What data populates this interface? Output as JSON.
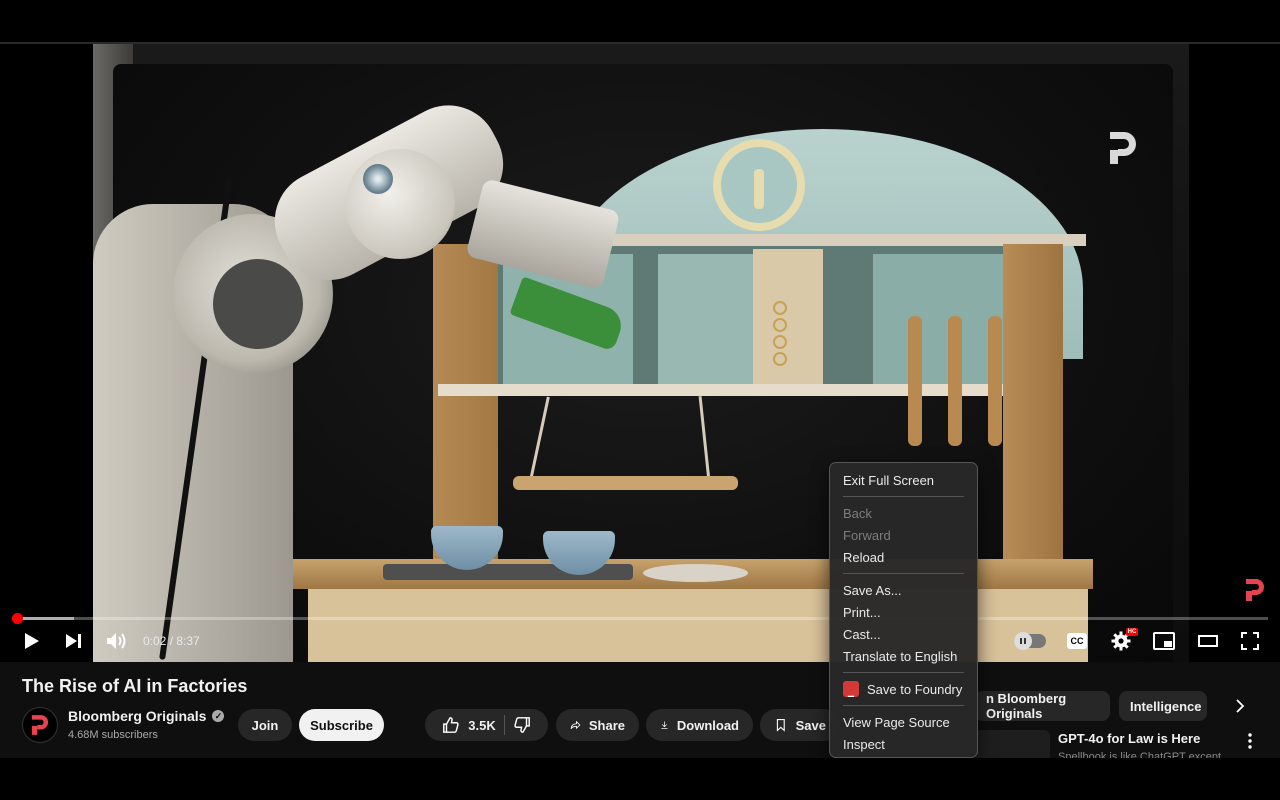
{
  "video": {
    "current_time": "0:02",
    "duration": "8:37",
    "time_separator": " / ",
    "cc_label": "CC",
    "hd_label": "HC",
    "progress": 0.004
  },
  "info": {
    "title": "The Rise of AI in Factories",
    "channel_name": "Bloomberg Originals",
    "subscribers": "4.68M subscribers",
    "join_label": "Join",
    "subscribe_label": "Subscribe",
    "like_count": "3.5K",
    "share_label": "Share",
    "download_label": "Download",
    "save_label": "Save"
  },
  "chips": [
    {
      "label": "n Bloomberg Originals"
    },
    {
      "label": "Intelligence"
    }
  ],
  "recommendation": {
    "title": "GPT-4o for Law is Here",
    "subtitle": "Spellbook is like ChatGPT except"
  },
  "context_menu": {
    "items": [
      {
        "label": "Exit Full Screen",
        "enabled": true
      },
      {
        "label": "Back",
        "enabled": false
      },
      {
        "label": "Forward",
        "enabled": false
      },
      {
        "label": "Reload",
        "enabled": true
      },
      {
        "label": "Save As...",
        "enabled": true
      },
      {
        "label": "Print...",
        "enabled": true
      },
      {
        "label": "Cast...",
        "enabled": true
      },
      {
        "label": "Translate to English",
        "enabled": true
      },
      {
        "label": "Save to Foundry",
        "enabled": true
      },
      {
        "label": "View Page Source",
        "enabled": true
      },
      {
        "label": "Inspect",
        "enabled": true
      }
    ]
  },
  "colors": {
    "progress": "#ff0000",
    "brand": "#d23a3a",
    "background": "#0f0f0f"
  }
}
